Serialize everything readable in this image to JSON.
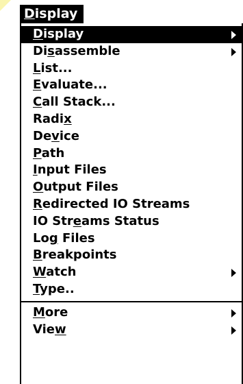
{
  "menubar": {
    "title": "Display",
    "mnemonic_index": 0
  },
  "menu": {
    "groups": [
      {
        "items": [
          {
            "label": "Display",
            "mnemonic_index": 0,
            "submenu": true,
            "selected": true
          },
          {
            "label": "Disassemble",
            "mnemonic_index": 2,
            "submenu": true
          },
          {
            "label": "List...",
            "mnemonic_index": 0
          },
          {
            "label": "Evaluate...",
            "mnemonic_index": 0
          },
          {
            "label": "Call Stack...",
            "mnemonic_index": 0
          },
          {
            "label": "Radix",
            "mnemonic_index": 4
          },
          {
            "label": "Device",
            "mnemonic_index": 2
          },
          {
            "label": "Path",
            "mnemonic_index": 0
          },
          {
            "label": "Input Files",
            "mnemonic_index": 0
          },
          {
            "label": "Output Files",
            "mnemonic_index": 0
          },
          {
            "label": "Redirected IO Streams",
            "mnemonic_index": 0
          },
          {
            "label": "IO Streams Status",
            "mnemonic_index": 6
          },
          {
            "label": "Log Files",
            "mnemonic_index": 2
          },
          {
            "label": "Breakpoints",
            "mnemonic_index": 0
          },
          {
            "label": "Watch",
            "mnemonic_index": 0,
            "submenu": true
          },
          {
            "label": "Type..",
            "mnemonic_index": 0
          }
        ]
      },
      {
        "items": [
          {
            "label": "More",
            "mnemonic_index": 0,
            "submenu": true
          },
          {
            "label": "View",
            "mnemonic_index": 3,
            "submenu": true
          }
        ]
      }
    ]
  }
}
